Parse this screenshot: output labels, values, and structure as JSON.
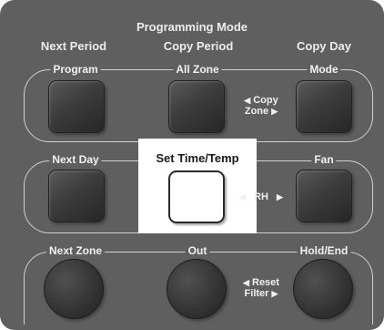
{
  "header": {
    "programming_mode": "Programming Mode",
    "next_period": "Next Period",
    "copy_period": "Copy Period",
    "copy_day": "Copy Day"
  },
  "row1": {
    "program": "Program",
    "all_zone": "All Zone",
    "mode": "Mode",
    "copy_zone_line1": "Copy",
    "copy_zone_line2": "Zone"
  },
  "row2": {
    "next_day": "Next Day",
    "set_time_temp": "Set Time/Temp",
    "fan": "Fan",
    "rh": "RH"
  },
  "row3": {
    "next_zone": "Next Zone",
    "out": "Out",
    "hold_end": "Hold/End",
    "reset_filter_line1": "Reset",
    "reset_filter_line2": "Filter"
  },
  "icons": {
    "left_arrow": "◀",
    "right_arrow": "▶"
  }
}
